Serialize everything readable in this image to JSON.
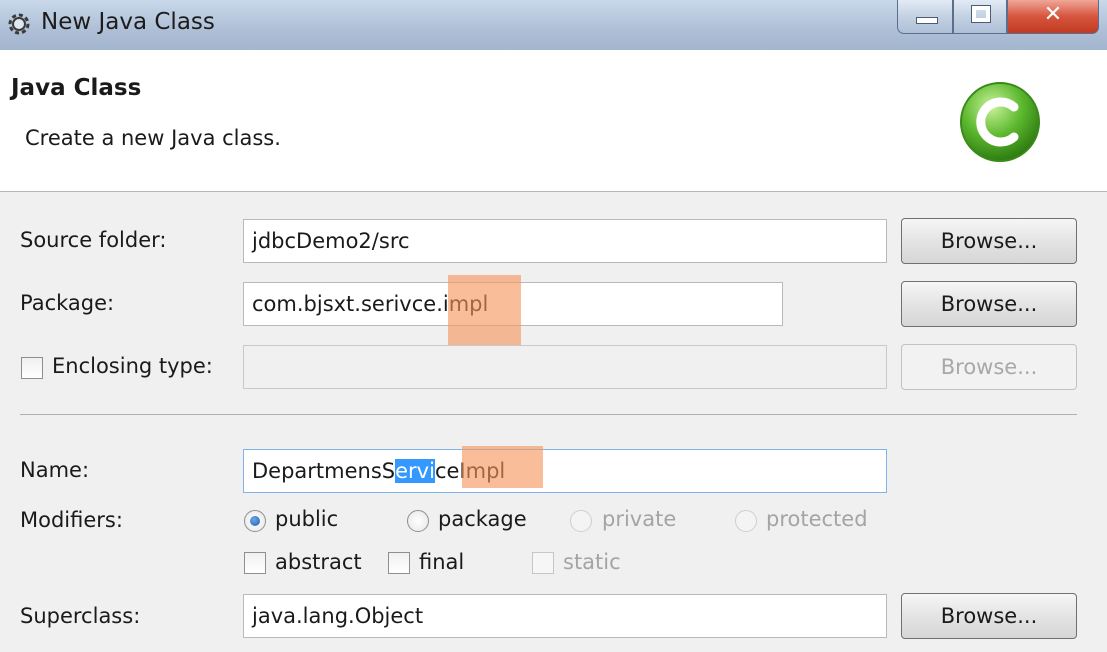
{
  "window": {
    "title": "New Java Class"
  },
  "banner": {
    "title": "Java Class",
    "description": "Create a new Java class."
  },
  "form": {
    "source_folder": {
      "label": "Source folder:",
      "value": "jdbcDemo2/src",
      "browse": "Browse..."
    },
    "package": {
      "label": "Package:",
      "value": "com.bjsxt.serivce.impl",
      "browse": "Browse..."
    },
    "enclosing_type": {
      "label": "Enclosing type:",
      "value": "",
      "browse": "Browse...",
      "checked": false
    },
    "name": {
      "label": "Name:",
      "value_before": "DepartmensS",
      "value_selected": "ervi",
      "value_after": "ceImpl"
    },
    "modifiers": {
      "label": "Modifiers:",
      "visibility": [
        "public",
        "package",
        "private",
        "protected"
      ],
      "selected": "public",
      "flags": [
        "abstract",
        "final",
        "static"
      ]
    },
    "superclass": {
      "label": "Superclass:",
      "value": "java.lang.Object",
      "browse": "Browse..."
    }
  },
  "colors": {
    "selection": "#3399ff",
    "highlight": "#f5965a",
    "icon_green": "#5cb82e"
  },
  "icons": {
    "app": "gear-icon",
    "class": "java-class-icon"
  }
}
